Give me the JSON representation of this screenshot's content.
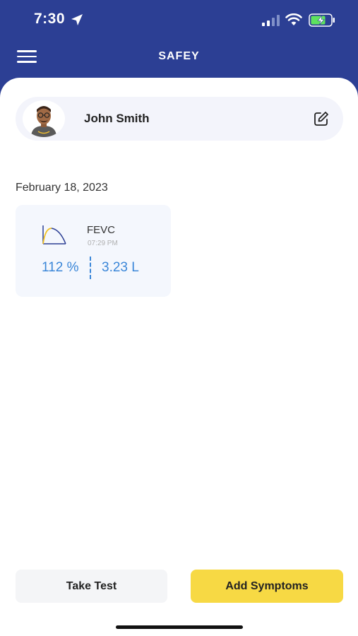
{
  "status_bar": {
    "time": "7:30"
  },
  "header": {
    "title": "SAFEY"
  },
  "profile": {
    "name": "John Smith"
  },
  "records": {
    "date": "February 18, 2023",
    "items": [
      {
        "name": "FEVC",
        "time": "07:29 PM",
        "percent": "112 %",
        "volume": "3.23 L"
      }
    ]
  },
  "actions": {
    "take_test": "Take Test",
    "add_symptoms": "Add Symptoms"
  },
  "colors": {
    "header_bg": "#2c3f94",
    "accent_blue": "#3a86d8",
    "accent_yellow": "#f7d944"
  },
  "icons": [
    "location-arrow-icon",
    "signal-icon",
    "wifi-icon",
    "battery-charging-icon",
    "hamburger-menu-icon",
    "edit-icon",
    "flow-volume-graph-icon"
  ]
}
